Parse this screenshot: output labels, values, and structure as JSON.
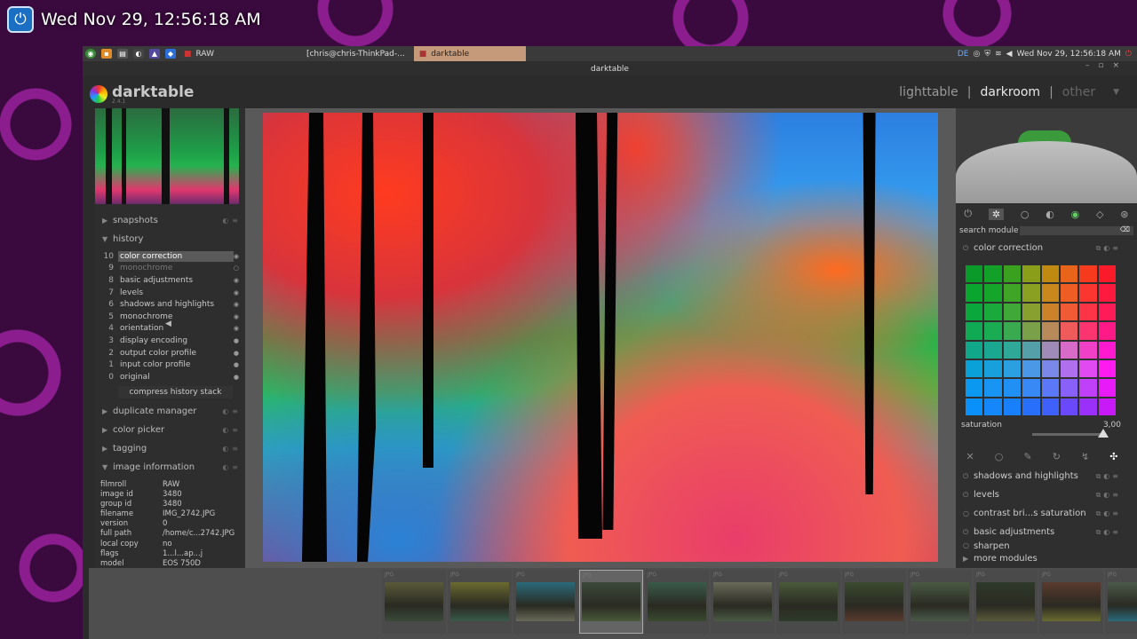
{
  "desktop": {
    "clock": "Wed Nov 29, 12:56:18 AM"
  },
  "panel": {
    "tasks": [
      {
        "label": "RAW"
      },
      {
        "label": "[chris@chris-ThinkPad-..."
      },
      {
        "label": "darktable",
        "active": true
      }
    ],
    "tray_lang": "DE",
    "tray_clock": "Wed Nov 29, 12:56:18 AM"
  },
  "window": {
    "title": "darktable"
  },
  "app": {
    "logo": "darktable",
    "version": "2.4.1"
  },
  "views": {
    "lighttable": "lighttable",
    "sep": "|",
    "darkroom": "darkroom",
    "other": "other"
  },
  "left": {
    "sections": {
      "snapshots": "snapshots",
      "history": "history",
      "duplicate": "duplicate manager",
      "color_picker": "color picker",
      "tagging": "tagging",
      "image_info": "image information"
    },
    "history": [
      {
        "n": "10",
        "label": "color correction"
      },
      {
        "n": "9",
        "label": "monochrome"
      },
      {
        "n": "8",
        "label": "basic adjustments"
      },
      {
        "n": "7",
        "label": "levels"
      },
      {
        "n": "6",
        "label": "shadows and highlights"
      },
      {
        "n": "5",
        "label": "monochrome"
      },
      {
        "n": "4",
        "label": "orientation"
      },
      {
        "n": "3",
        "label": "display encoding"
      },
      {
        "n": "2",
        "label": "output color profile"
      },
      {
        "n": "1",
        "label": "input color profile"
      },
      {
        "n": "0",
        "label": "original"
      }
    ],
    "compress": "compress history stack",
    "info": [
      {
        "k": "filmroll",
        "v": "RAW"
      },
      {
        "k": "image id",
        "v": "3480"
      },
      {
        "k": "group id",
        "v": "3480"
      },
      {
        "k": "filename",
        "v": "IMG_2742.JPG"
      },
      {
        "k": "version",
        "v": "0"
      },
      {
        "k": "full path",
        "v": "/home/c...2742.JPG"
      },
      {
        "k": "local copy",
        "v": "no"
      },
      {
        "k": "flags",
        "v": "1...l...ap...j"
      },
      {
        "k": "model",
        "v": "EOS 750D"
      }
    ]
  },
  "right": {
    "search_label": "search module",
    "color_correction": "color correction",
    "saturation_label": "saturation",
    "saturation_value": "3,00",
    "modules": [
      "shadows and highlights",
      "levels",
      "contrast bri...s saturation",
      "basic adjustments",
      "sharpen"
    ],
    "more_modules": "more modules"
  },
  "filmstrip": {
    "label": "JPG",
    "count": 12,
    "current": 3
  }
}
